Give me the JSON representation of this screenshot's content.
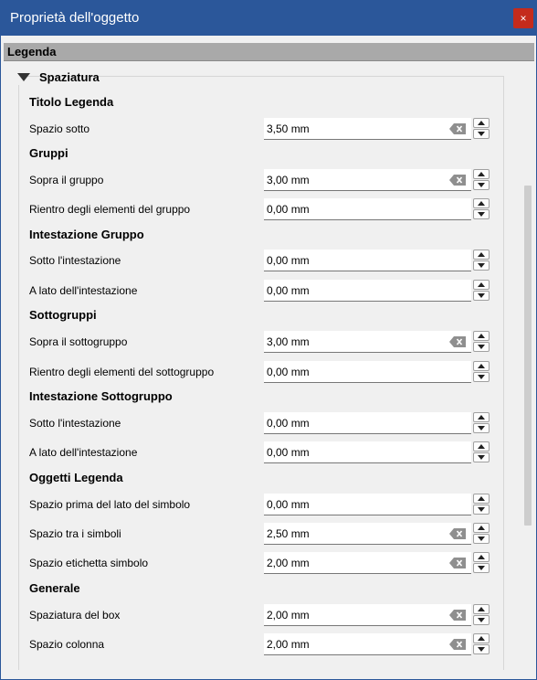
{
  "window": {
    "title": "Proprietà dell'oggetto",
    "close_symbol": "×"
  },
  "section": {
    "title": "Legenda"
  },
  "group": {
    "title": "Spaziatura",
    "expanded": true
  },
  "clear_icon": "clear-text-icon",
  "rows": [
    {
      "type": "heading",
      "label": "Titolo Legenda"
    },
    {
      "type": "field",
      "label": "Spazio sotto",
      "value": "3,50 mm",
      "clearable": true
    },
    {
      "type": "heading",
      "label": "Gruppi"
    },
    {
      "type": "field",
      "label": "Sopra il gruppo",
      "value": "3,00 mm",
      "clearable": true
    },
    {
      "type": "field",
      "label": "Rientro degli elementi del gruppo",
      "value": "0,00 mm",
      "clearable": false
    },
    {
      "type": "heading",
      "label": "Intestazione Gruppo"
    },
    {
      "type": "field",
      "label": "Sotto l'intestazione",
      "value": "0,00 mm",
      "clearable": false
    },
    {
      "type": "field",
      "label": "A lato dell'intestazione",
      "value": "0,00 mm",
      "clearable": false
    },
    {
      "type": "heading",
      "label": "Sottogruppi"
    },
    {
      "type": "field",
      "label": "Sopra il sottogruppo",
      "value": "3,00 mm",
      "clearable": true
    },
    {
      "type": "field",
      "label": "Rientro degli elementi del sottogruppo",
      "value": "0,00 mm",
      "clearable": false
    },
    {
      "type": "heading",
      "label": "Intestazione Sottogruppo"
    },
    {
      "type": "field",
      "label": "Sotto l'intestazione",
      "value": "0,00 mm",
      "clearable": false
    },
    {
      "type": "field",
      "label": "A lato dell'intestazione",
      "value": "0,00 mm",
      "clearable": false
    },
    {
      "type": "heading",
      "label": "Oggetti Legenda"
    },
    {
      "type": "field",
      "label": "Spazio prima del lato del simbolo",
      "value": "0,00 mm",
      "clearable": false
    },
    {
      "type": "field",
      "label": "Spazio tra i simboli",
      "value": "2,50 mm",
      "clearable": true
    },
    {
      "type": "field",
      "label": "Spazio etichetta simbolo",
      "value": "2,00 mm",
      "clearable": true
    },
    {
      "type": "heading",
      "label": "Generale"
    },
    {
      "type": "field",
      "label": "Spaziatura del box",
      "value": "2,00 mm",
      "clearable": true
    },
    {
      "type": "field",
      "label": "Spazio colonna",
      "value": "2,00 mm",
      "clearable": true
    }
  ]
}
